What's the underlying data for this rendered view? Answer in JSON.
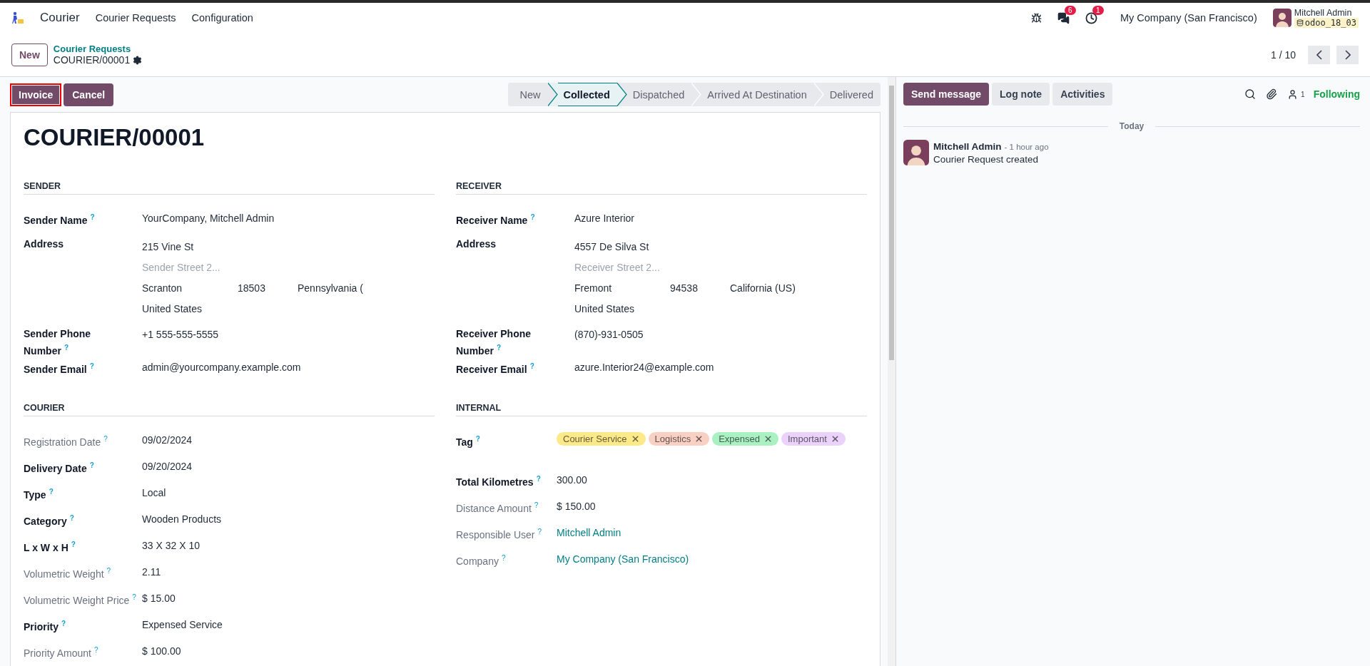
{
  "navbar": {
    "app_name": "Courier",
    "menus": [
      "Courier Requests",
      "Configuration"
    ],
    "messages_count": "6",
    "activities_count": "1",
    "company": "My Company (San Francisco)",
    "user": {
      "name": "Mitchell Admin",
      "database": "odoo_18_03"
    }
  },
  "control_panel": {
    "new_button": "New",
    "breadcrumb": "Courier Requests",
    "record": "COURIER/00001",
    "pager": "1 / 10"
  },
  "actions": [
    {
      "label": "Invoice",
      "highlighted": true
    },
    {
      "label": "Cancel",
      "highlighted": false
    }
  ],
  "stages": [
    {
      "label": "New",
      "selected": false
    },
    {
      "label": "Collected",
      "selected": true
    },
    {
      "label": "Dispatched",
      "selected": false
    },
    {
      "label": "Arrived At Destination",
      "selected": false
    },
    {
      "label": "Delivered",
      "selected": false
    }
  ],
  "form": {
    "title": "COURIER/00001",
    "sections": [
      {
        "title": "SENDER",
        "fields": [
          {
            "kind": "text",
            "label": "Sender Name",
            "tooltip": "?",
            "required": true,
            "value": "YourCompany, Mitchell Admin"
          },
          {
            "kind": "address",
            "label": "Address",
            "required": true,
            "street": "215 Vine St",
            "street2": {
              "placeholder": "Sender Street 2..."
            },
            "city": "Scranton",
            "zip": "18503",
            "state": "Pennsylvania (",
            "country": "United States"
          },
          {
            "kind": "text",
            "label": "Sender Phone Number",
            "tooltip": "?",
            "required": true,
            "value": "+1 555-555-5555"
          },
          {
            "kind": "text",
            "label": "Sender Email",
            "tooltip": "?",
            "required": true,
            "value": "admin@yourcompany.example.com"
          }
        ]
      },
      {
        "title": "RECEIVER",
        "fields": [
          {
            "kind": "text",
            "label": "Receiver Name",
            "tooltip": "?",
            "required": true,
            "value": "Azure Interior"
          },
          {
            "kind": "address",
            "label": "Address",
            "required": true,
            "street": "4557 De Silva St",
            "street2": {
              "placeholder": "Receiver Street 2..."
            },
            "city": "Fremont",
            "zip": "94538",
            "state": "California (US)",
            "country": "United States"
          },
          {
            "kind": "text",
            "label": "Receiver Phone Number",
            "tooltip": "?",
            "required": true,
            "value": "(870)-931-0505"
          },
          {
            "kind": "text",
            "label": "Receiver Email",
            "tooltip": "?",
            "required": true,
            "value": "azure.Interior24@example.com"
          }
        ]
      },
      {
        "title": "COURIER",
        "fields": [
          {
            "kind": "text",
            "label": "Registration Date",
            "tooltip": "?",
            "required": false,
            "value": "09/02/2024"
          },
          {
            "kind": "text",
            "label": "Delivery Date",
            "tooltip": "?",
            "required": true,
            "value": "09/20/2024"
          },
          {
            "kind": "text",
            "label": "Type",
            "tooltip": "?",
            "required": true,
            "value": "Local"
          },
          {
            "kind": "text",
            "label": "Category",
            "tooltip": "?",
            "required": true,
            "value": "Wooden Products"
          },
          {
            "kind": "text",
            "label": "L x W x H",
            "tooltip": "?",
            "required": true,
            "value": "33 X 32 X 10"
          },
          {
            "kind": "text",
            "label": "Volumetric Weight",
            "tooltip": "?",
            "required": false,
            "value": "2.11"
          },
          {
            "kind": "text",
            "label": "Volumetric Weight Price",
            "tooltip": "?",
            "required": false,
            "value": "$ 15.00"
          },
          {
            "kind": "text",
            "label": "Priority",
            "tooltip": "?",
            "required": true,
            "value": "Expensed Service"
          },
          {
            "kind": "text",
            "label": "Priority Amount",
            "tooltip": "?",
            "required": false,
            "value": "$ 100.00"
          }
        ]
      },
      {
        "title": "INTERNAL",
        "fields": [
          {
            "kind": "tags",
            "label": "Tag",
            "tooltip": "?",
            "required": true,
            "tags": [
              {
                "label": "Courier Service",
                "color": "#fbe98a"
              },
              {
                "label": "Logistics",
                "color": "#f9d0c4"
              },
              {
                "label": "Expensed",
                "color": "#a9f0c2"
              },
              {
                "label": "Important",
                "color": "#ead2fb"
              }
            ]
          },
          {
            "kind": "text",
            "label": "Total Kilometres",
            "tooltip": "?",
            "required": true,
            "value": "300.00"
          },
          {
            "kind": "text",
            "label": "Distance Amount",
            "tooltip": "?",
            "required": false,
            "value": "$ 150.00"
          },
          {
            "kind": "link",
            "label": "Responsible User",
            "tooltip": "?",
            "required": false,
            "value": "Mitchell Admin"
          },
          {
            "kind": "link",
            "label": "Company",
            "tooltip": "?",
            "required": false,
            "value": "My Company (San Francisco)"
          }
        ]
      }
    ]
  },
  "chatter": {
    "buttons": [
      {
        "label": "Send message",
        "selected": true
      },
      {
        "label": "Log note",
        "selected": false
      },
      {
        "label": "Activities",
        "selected": false
      }
    ],
    "followers_count": "1",
    "follow_label": "Following",
    "date_separator": "Today",
    "messages": [
      {
        "author": "Mitchell Admin",
        "time": "- 1 hour ago",
        "body": "Courier Request created"
      }
    ]
  }
}
